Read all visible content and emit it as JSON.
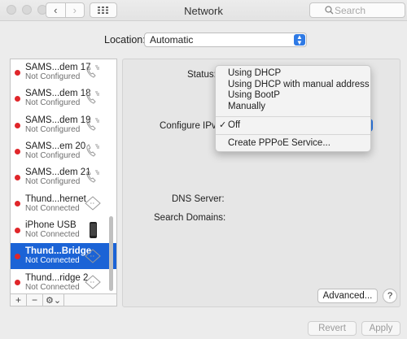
{
  "window": {
    "title": "Network"
  },
  "search": {
    "placeholder": "Search"
  },
  "location": {
    "label": "Location:",
    "value": "Automatic"
  },
  "services": [
    {
      "name": "SAMS...dem 17",
      "status": "Not Configured",
      "icon": "phone-modem-icon"
    },
    {
      "name": "SAMS...dem 18",
      "status": "Not Configured",
      "icon": "phone-modem-icon"
    },
    {
      "name": "SAMS...dem 19",
      "status": "Not Configured",
      "icon": "phone-modem-icon"
    },
    {
      "name": "SAMS...em 20",
      "status": "Not Configured",
      "icon": "phone-modem-icon"
    },
    {
      "name": "SAMS...dem 21",
      "status": "Not Configured",
      "icon": "phone-modem-icon"
    },
    {
      "name": "Thund...hernet",
      "status": "Not Connected",
      "icon": "ethernet-icon"
    },
    {
      "name": "iPhone USB",
      "status": "Not Connected",
      "icon": "iphone-icon"
    },
    {
      "name": "Thund...Bridge",
      "status": "Not Connected",
      "icon": "ethernet-icon",
      "selected": true
    },
    {
      "name": "Thund...ridge 2",
      "status": "Not Connected",
      "icon": "ethernet-icon"
    }
  ],
  "list_bar": {
    "add": "+",
    "remove": "−",
    "gear": "⚙⌄"
  },
  "details": {
    "status_label": "Status:",
    "configure_ipv4_label": "Configure IPv4:",
    "dns_label": "DNS Server:",
    "search_domains_label": "Search Domains:"
  },
  "menu": {
    "items": [
      "Using DHCP",
      "Using DHCP with manual address",
      "Using BootP",
      "Manually"
    ],
    "off": {
      "label": "Off",
      "check": "✓"
    },
    "pppoe": "Create PPPoE Service..."
  },
  "buttons": {
    "advanced": "Advanced...",
    "help": "?",
    "revert": "Revert",
    "apply": "Apply"
  },
  "colors": {
    "accent": "#1b63d6",
    "status_red": "#e0262a"
  }
}
